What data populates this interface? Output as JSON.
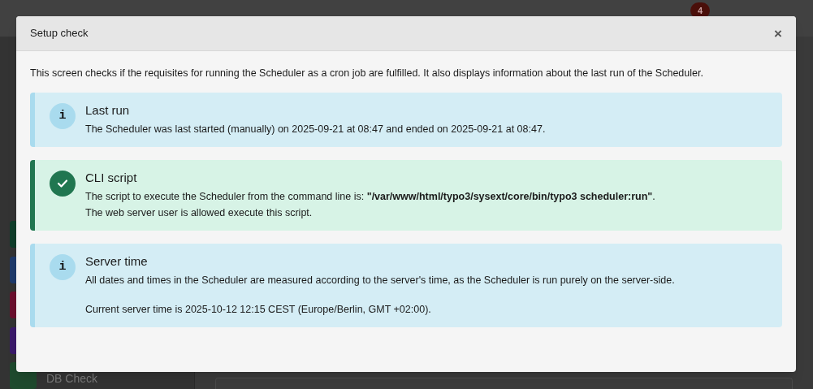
{
  "background": {
    "notification_count": "4",
    "module_items": [
      {
        "color": "#0f3d2a"
      },
      {
        "color": "#1e3a6b"
      },
      {
        "color": "#6b0f2e"
      },
      {
        "color": "#3b1a6b"
      },
      {
        "color": "#1f4a2e",
        "label": "DB Check"
      }
    ]
  },
  "modal": {
    "title": "Setup check",
    "close": "×",
    "intro": "This screen checks if the requisites for running the Scheduler as a cron job are fulfilled. It also displays information about the last run of the Scheduler.",
    "callouts": [
      {
        "kind": "info",
        "icon": "i",
        "title": "Last run",
        "paragraphs": [
          "The Scheduler was last started (manually) on 2025-09-21 at 08:47 and ended on 2025-09-21 at 08:47."
        ]
      },
      {
        "kind": "success",
        "title": "CLI script",
        "paragraphs": [
          "The script to execute the Scheduler from the command line is: **\"/var/www/html/typo3/sysext/core/bin/typo3 scheduler:run\"**.\nThe web server user is allowed execute this script."
        ]
      },
      {
        "kind": "info",
        "icon": "i",
        "title": "Server time",
        "paragraphs": [
          "All dates and times in the Scheduler are measured according to the server's time, as the Scheduler is run purely on the server-side.",
          "Current server time is 2025-10-12 12:15 CEST (Europe/Berlin, GMT +02:00)."
        ]
      }
    ]
  }
}
